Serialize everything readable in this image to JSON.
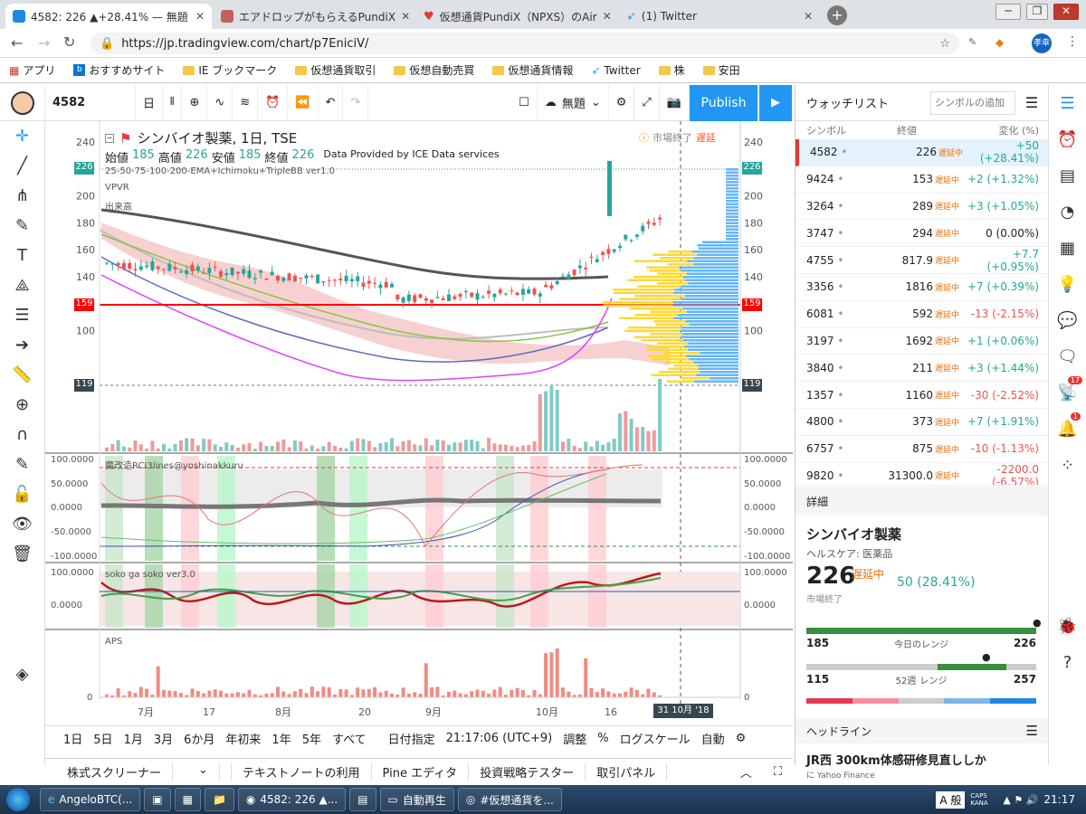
{
  "browser": {
    "tabs": [
      {
        "title": "4582: 226 ▲+28.41% — 無題",
        "color": "#1e88e5"
      },
      {
        "title": "エアドロップがもらえるPundiX",
        "color": "#c0645a"
      },
      {
        "title": "仮想通貨PundiX（NPXS）のAir",
        "color": "#e53935"
      },
      {
        "title": "(1) Twitter",
        "color": "#1da1f2"
      }
    ],
    "url": "https://jp.tradingview.com/chart/p7EniciV/",
    "profile": "孝幸",
    "bookmarks": [
      "アプリ",
      "おすすめサイト",
      "IE ブックマーク",
      "仮想通貨取引",
      "仮想自動売買",
      "仮想通貨情報",
      "Twitter",
      "株",
      "安田"
    ]
  },
  "toolbar": {
    "symbol": "4582",
    "interval": "日",
    "layout_name": "無題",
    "publish": "Publish"
  },
  "chart": {
    "title": "シンバイオ製薬, 1日, TSE",
    "ohlc_labels": [
      "始値",
      "高値",
      "安値",
      "終値"
    ],
    "ohlc_values": [
      "185",
      "226",
      "185",
      "226"
    ],
    "provider": "Data Provided by ICE Data services",
    "market_status": "市場終了",
    "delay": "遅延",
    "indicators": [
      "25-50-75-100-200-EMA+Ichimoku+TripleBB ver1.0",
      "VPVR",
      "出来高"
    ],
    "price_ticks": [
      "240",
      "220",
      "200",
      "180",
      "160",
      "140",
      "120",
      "100"
    ],
    "price_tags": {
      "last": "226",
      "line": "159",
      "low": "119"
    },
    "rci_label": "魔改造RCI3lines@yoshinakkuru",
    "rci_ticks": [
      "100.0000",
      "50.0000",
      "0.0000",
      "-50.0000",
      "-100.0000"
    ],
    "soko_label": "soko ga soko ver3.0",
    "soko_ticks": [
      "100.0000",
      "0.0000"
    ],
    "aps_label": "APS",
    "aps_ticks": [
      "0"
    ],
    "x_labels": [
      "7月",
      "17",
      "8月",
      "20",
      "9月",
      "10月",
      "16"
    ],
    "date_tag": "31 10月 '18",
    "colors": {
      "up": "#26a69a",
      "down": "#ef5350",
      "accent": "#2196f3"
    }
  },
  "bottom": {
    "ranges": [
      "1日",
      "5日",
      "1月",
      "3月",
      "6か月",
      "年初来",
      "1年",
      "5年",
      "すべて"
    ],
    "goto_date": "日付指定",
    "time": "21:17:06 (UTC+9)",
    "options": [
      "調整",
      "%",
      "ログスケール",
      "自動"
    ]
  },
  "panels": [
    "株式スクリーナー",
    "テキストノートの利用",
    "Pine エディタ",
    "投資戦略テスター",
    "取引パネル"
  ],
  "watchlist": {
    "title": "ウォッチリスト",
    "add_placeholder": "シンボルの追加",
    "headers": [
      "シンボル",
      "終値",
      "変化 (%)"
    ],
    "status": "遅延中",
    "rows": [
      {
        "sym": "4582",
        "last": "226",
        "chg": "+50 (+28.41%)",
        "dir": "up"
      },
      {
        "sym": "9424",
        "last": "153",
        "chg": "+2 (+1.32%)",
        "dir": "up"
      },
      {
        "sym": "3264",
        "last": "289",
        "chg": "+3 (+1.05%)",
        "dir": "up"
      },
      {
        "sym": "3747",
        "last": "294",
        "chg": "0 (0.00%)",
        "dir": "flat"
      },
      {
        "sym": "4755",
        "last": "817.9",
        "chg": "+7.7 (+0.95%)",
        "dir": "up"
      },
      {
        "sym": "3356",
        "last": "1816",
        "chg": "+7 (+0.39%)",
        "dir": "up"
      },
      {
        "sym": "6081",
        "last": "592",
        "chg": "-13 (-2.15%)",
        "dir": "down"
      },
      {
        "sym": "3197",
        "last": "1692",
        "chg": "+1 (+0.06%)",
        "dir": "up"
      },
      {
        "sym": "3840",
        "last": "211",
        "chg": "+3 (+1.44%)",
        "dir": "up"
      },
      {
        "sym": "1357",
        "last": "1160",
        "chg": "-30 (-2.52%)",
        "dir": "down"
      },
      {
        "sym": "4800",
        "last": "373",
        "chg": "+7 (+1.91%)",
        "dir": "up"
      },
      {
        "sym": "6757",
        "last": "875",
        "chg": "-10 (-1.13%)",
        "dir": "down"
      },
      {
        "sym": "9820",
        "last": "31300.0",
        "chg": "-2200.0 (-6.57%)",
        "dir": "down"
      }
    ]
  },
  "detail": {
    "header": "詳細",
    "name": "シンバイオ製薬",
    "sector": "ヘルスケア: 医薬品",
    "price": "226",
    "delayed": "遅延中",
    "change": "50 (28.41%)",
    "market": "市場終了",
    "day_low": "185",
    "day_label": "今日のレンジ",
    "day_high": "226",
    "wk_low": "115",
    "wk_prefix": "52週",
    "wk_label": "レンジ",
    "wk_high": "257",
    "headlines_title": "ヘッドライン",
    "headline": "JR西 300km体感研修見直ししか",
    "headline_src": "に Yahoo Finance",
    "headline_time": "16分 前",
    "badge1": "17",
    "badge2": "1"
  },
  "taskbar": {
    "items": [
      "AngeloBTC(...",
      "4582: 226 ▲...",
      "自動再生",
      "#仮想通貨を..."
    ],
    "ime": "A 般",
    "clock": "21:17",
    "caps": "CAPS KANA"
  }
}
